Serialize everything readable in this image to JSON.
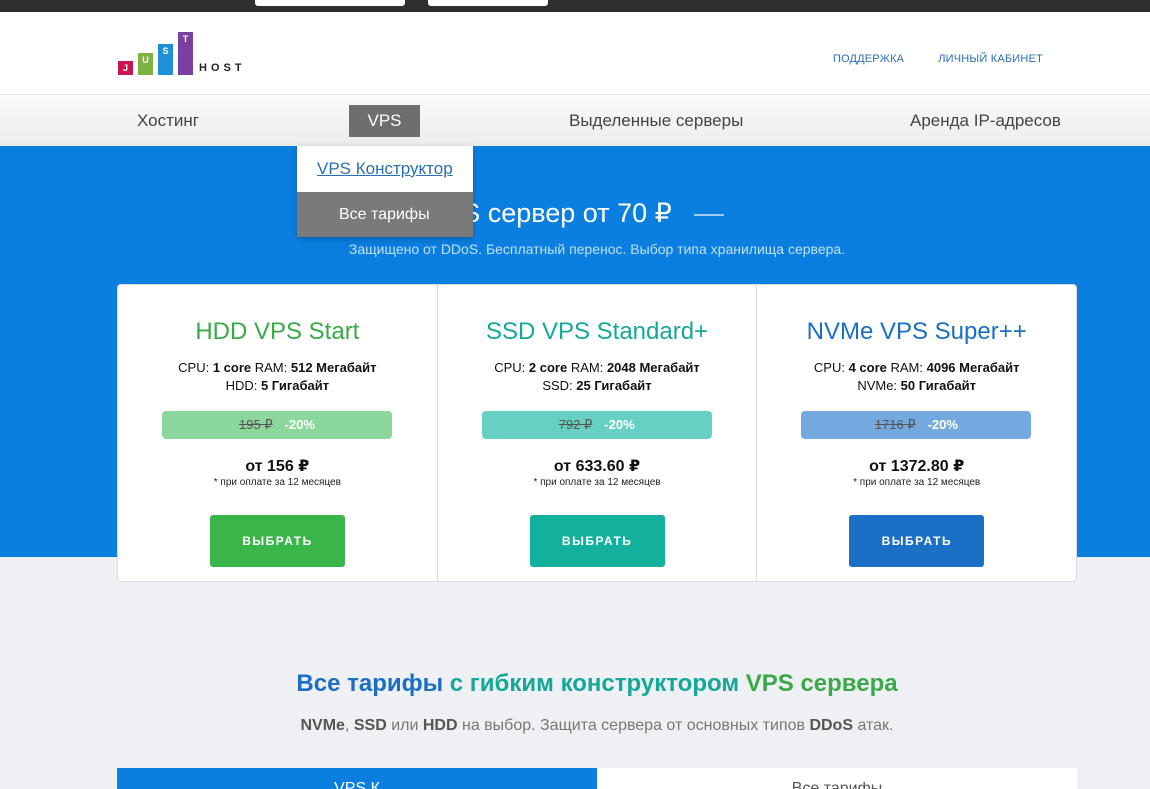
{
  "header": {
    "logo_letters": [
      "J",
      "U",
      "S",
      "T"
    ],
    "logo_host": "HOST",
    "links": [
      "ПОДДЕРЖКА",
      "ЛИЧНЫЙ КАБИНЕТ"
    ]
  },
  "nav": {
    "items": [
      "Хостинг",
      "VPS",
      "Выделенные серверы",
      "Аренда IP-адресов"
    ],
    "active": "VPS"
  },
  "dropdown": {
    "items": [
      "VPS Конструктор",
      "Все тарифы"
    ]
  },
  "hero": {
    "title": "VPS сервер от 70 ₽",
    "subtitle": "Защищено от DDoS. Бесплатный перенос. Выбор типа хранилища сервера."
  },
  "plans": [
    {
      "name": "HDD VPS Start",
      "color": "#3aa94a",
      "spec_line1": [
        "CPU: ",
        "1 core",
        " RAM: ",
        "512 Мегабайт"
      ],
      "spec_line2": [
        "HDD: ",
        "5 Гигабайт"
      ],
      "old_price": "195 ₽",
      "discount": "-20%",
      "discount_bg": "#8cd79b",
      "price": "от 156 ₽",
      "note": "* при оплате за 12 месяцев",
      "button": "ВЫБРАТЬ",
      "button_bg": "#39b54a"
    },
    {
      "name": "SSD VPS Standard+",
      "color": "#14a898",
      "spec_line1": [
        "CPU: ",
        "2 core",
        " RAM: ",
        "2048 Мегабайт"
      ],
      "spec_line2": [
        "SSD: ",
        "25 Гигабайт"
      ],
      "old_price": "792 ₽",
      "discount": "-20%",
      "discount_bg": "#66d1c2",
      "price": "от 633.60 ₽",
      "note": "* при оплате за 12 месяцев",
      "button": "ВЫБРАТЬ",
      "button_bg": "#12b09d"
    },
    {
      "name": "NVMe VPS Super++",
      "color": "#1a6fc4",
      "spec_line1": [
        "CPU: ",
        "4 core",
        " RAM: ",
        "4096 Мегабайт"
      ],
      "spec_line2": [
        "NVMe: ",
        "50 Гигабайт"
      ],
      "old_price": "1716 ₽",
      "discount": "-20%",
      "discount_bg": "#73a9de",
      "price": "от 1372.80 ₽",
      "note": "* при оплате за 12 месяцев",
      "button": "ВЫБРАТЬ",
      "button_bg": "#1b6fc4"
    }
  ],
  "section": {
    "title_part1": "Все тарифы",
    "title_part2": " с гибким конструктором ",
    "title_part3": "VPS сервера",
    "subtitle": [
      "NVMe",
      ", ",
      "SSD",
      " или ",
      "HDD",
      " на выбор. Защита сервера от основных типов ",
      "DDoS",
      " атак."
    ]
  },
  "tabs": [
    "VPS К",
    "Все тарифы"
  ]
}
